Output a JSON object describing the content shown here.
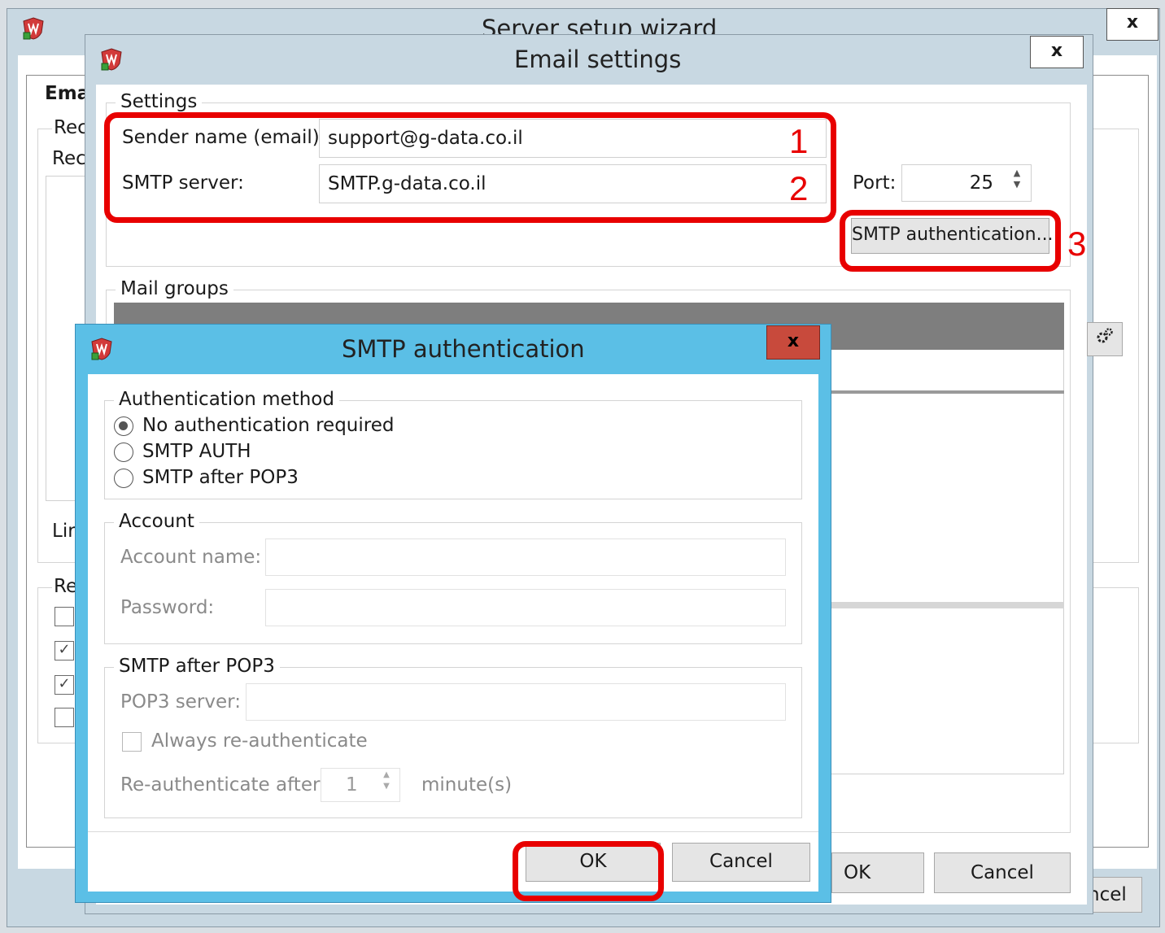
{
  "wizard": {
    "title": "Server setup wizard",
    "close_label": "x",
    "partial_labels": {
      "email": "Ema",
      "rec1": "Rec",
      "rec2": "Rec",
      "lin": "Lir",
      "re": "Re",
      "cancel": "ncel"
    },
    "checkbox_states": [
      false,
      true,
      true,
      false
    ]
  },
  "email_settings": {
    "title": "Email settings",
    "close_label": "x",
    "settings_group": "Settings",
    "sender_label": "Sender name (email):",
    "sender_value": "support@g-data.co.il",
    "smtp_label": "SMTP server:",
    "smtp_value": "SMTP.g-data.co.il",
    "port_label": "Port:",
    "port_value": "25",
    "smtp_auth_button": "SMTP authentication...",
    "mail_groups_group": "Mail groups",
    "ok": "OK",
    "cancel": "Cancel"
  },
  "smtp_auth": {
    "title": "SMTP authentication",
    "close_label": "x",
    "auth_method_group": "Authentication method",
    "options": [
      {
        "label": "No authentication required",
        "selected": true
      },
      {
        "label": "SMTP AUTH",
        "selected": false
      },
      {
        "label": "SMTP after POP3",
        "selected": false
      }
    ],
    "account_group": "Account",
    "account_name_label": "Account name:",
    "account_name_value": "",
    "password_label": "Password:",
    "password_value": "",
    "pop3_group": "SMTP after POP3",
    "pop3_server_label": "POP3 server:",
    "pop3_server_value": "",
    "always_reauth_label": "Always re-authenticate",
    "always_reauth_checked": false,
    "reauth_after_label": "Re-authenticate after",
    "reauth_value": "1",
    "minutes_label": "minute(s)",
    "ok": "OK",
    "cancel": "Cancel"
  },
  "annotations": {
    "n1": "1",
    "n2": "2",
    "n3": "3"
  },
  "colors": {
    "highlight": "#e80000",
    "dialog_frame": "#5bbfe6",
    "close_red": "#c84a3c"
  }
}
